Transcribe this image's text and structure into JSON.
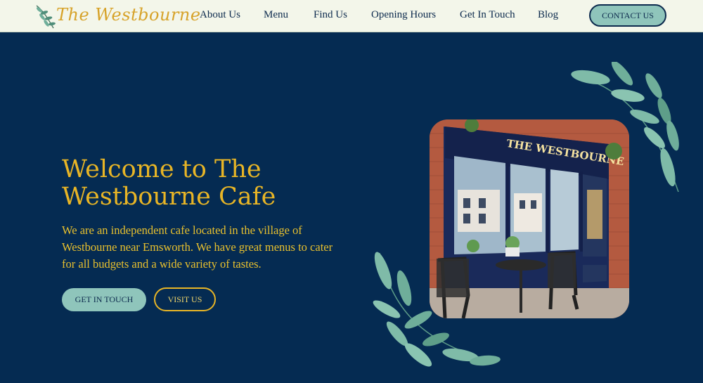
{
  "header": {
    "logo_text": "The Westbourne",
    "nav": [
      "About Us",
      "Menu",
      "Find Us",
      "Opening Hours",
      "Get In Touch",
      "Blog"
    ],
    "contact_label": "CONTACT US"
  },
  "hero": {
    "title": "Welcome to The Westbourne Cafe",
    "description": "We are an independent cafe located in the village of Westbourne near Emsworth. We have great menus to cater for all budgets and a wide variety of tastes.",
    "primary_button": "GET IN TOUCH",
    "secondary_button": "VISIT US",
    "photo_sign": "THE WESTBOURNE"
  },
  "colors": {
    "background": "#052b52",
    "header_bg": "#f3f6ea",
    "gold": "#e8b526",
    "teal_button": "#8fc5bb",
    "navy_text": "#0c2a4d",
    "leaf_green": "#6fae9a"
  },
  "icons": [
    "leaf-sprig-icon",
    "leaf-branch-decoration"
  ]
}
